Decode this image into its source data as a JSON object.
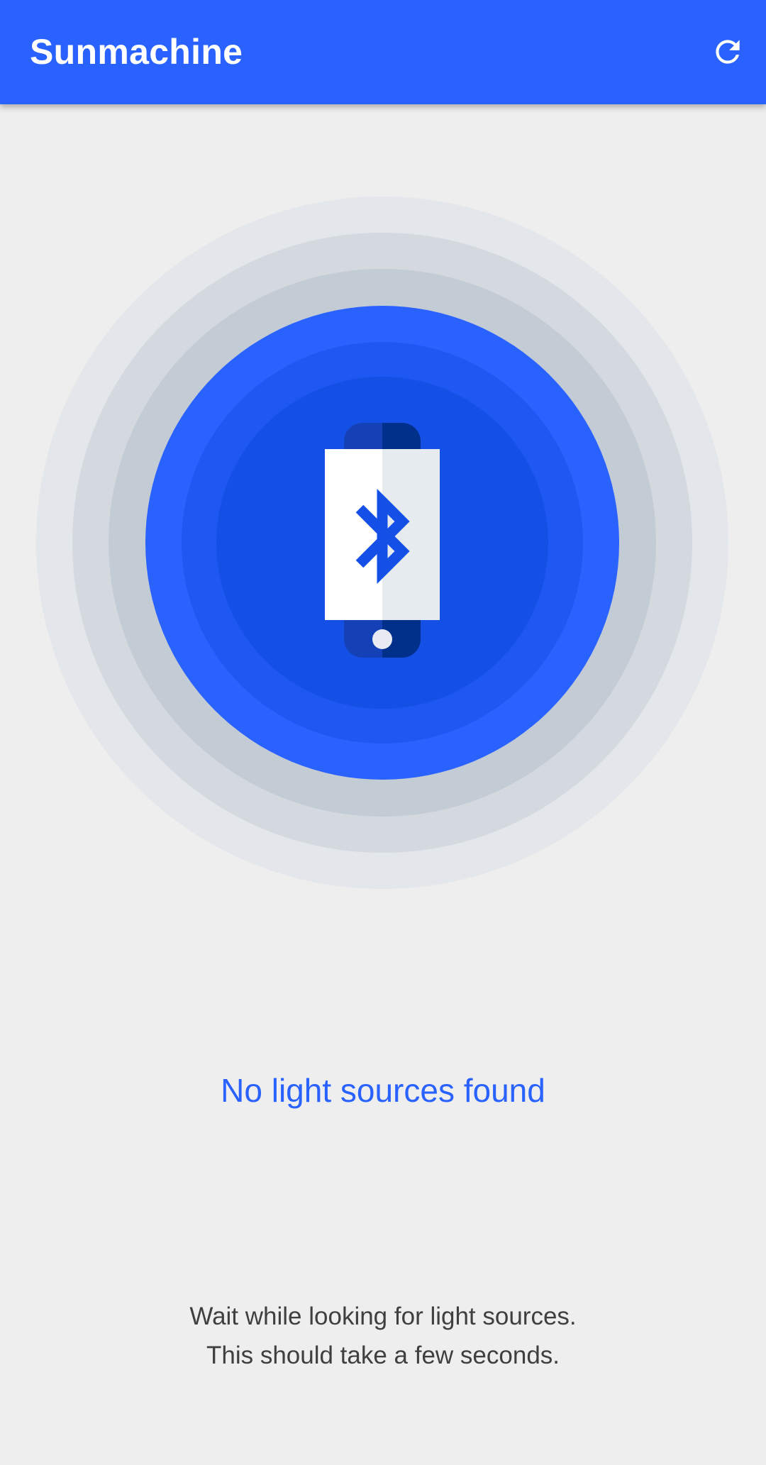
{
  "app_bar": {
    "title": "Sunmachine",
    "refresh_icon": "refresh-icon"
  },
  "scan_illustration": {
    "icon": "phone-bluetooth-icon",
    "ring_colors": [
      "#e3e6ea",
      "#d3d9df",
      "#c3cbd4",
      "#2962ff",
      "#1e57f2",
      "#1550e6"
    ]
  },
  "status": {
    "title": "No light sources found"
  },
  "hint": {
    "line1": "Wait while looking for light sources.",
    "line2": "This should take a few seconds."
  },
  "colors": {
    "accent": "#2962ff",
    "background": "#eeeeee",
    "hint_text": "#3f3f3f"
  }
}
